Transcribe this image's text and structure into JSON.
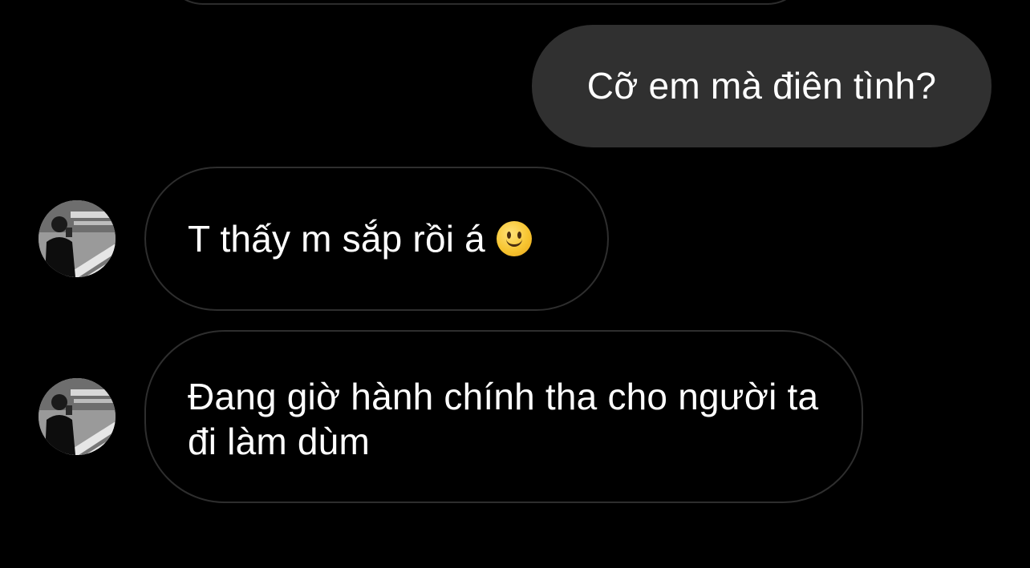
{
  "messages": [
    {
      "direction": "outgoing",
      "text": "Cỡ em mà điên tình?"
    },
    {
      "direction": "incoming",
      "text": "T thấy m sắp rồi á",
      "emoji": "slightly-smiling-face-icon"
    },
    {
      "direction": "incoming",
      "text": "Đang giờ hành chính tha cho người ta đi làm dùm"
    }
  ],
  "colors": {
    "background": "#000000",
    "outgoing_bubble": "#303030",
    "incoming_border": "#2e2e2e",
    "text": "#ffffff"
  }
}
